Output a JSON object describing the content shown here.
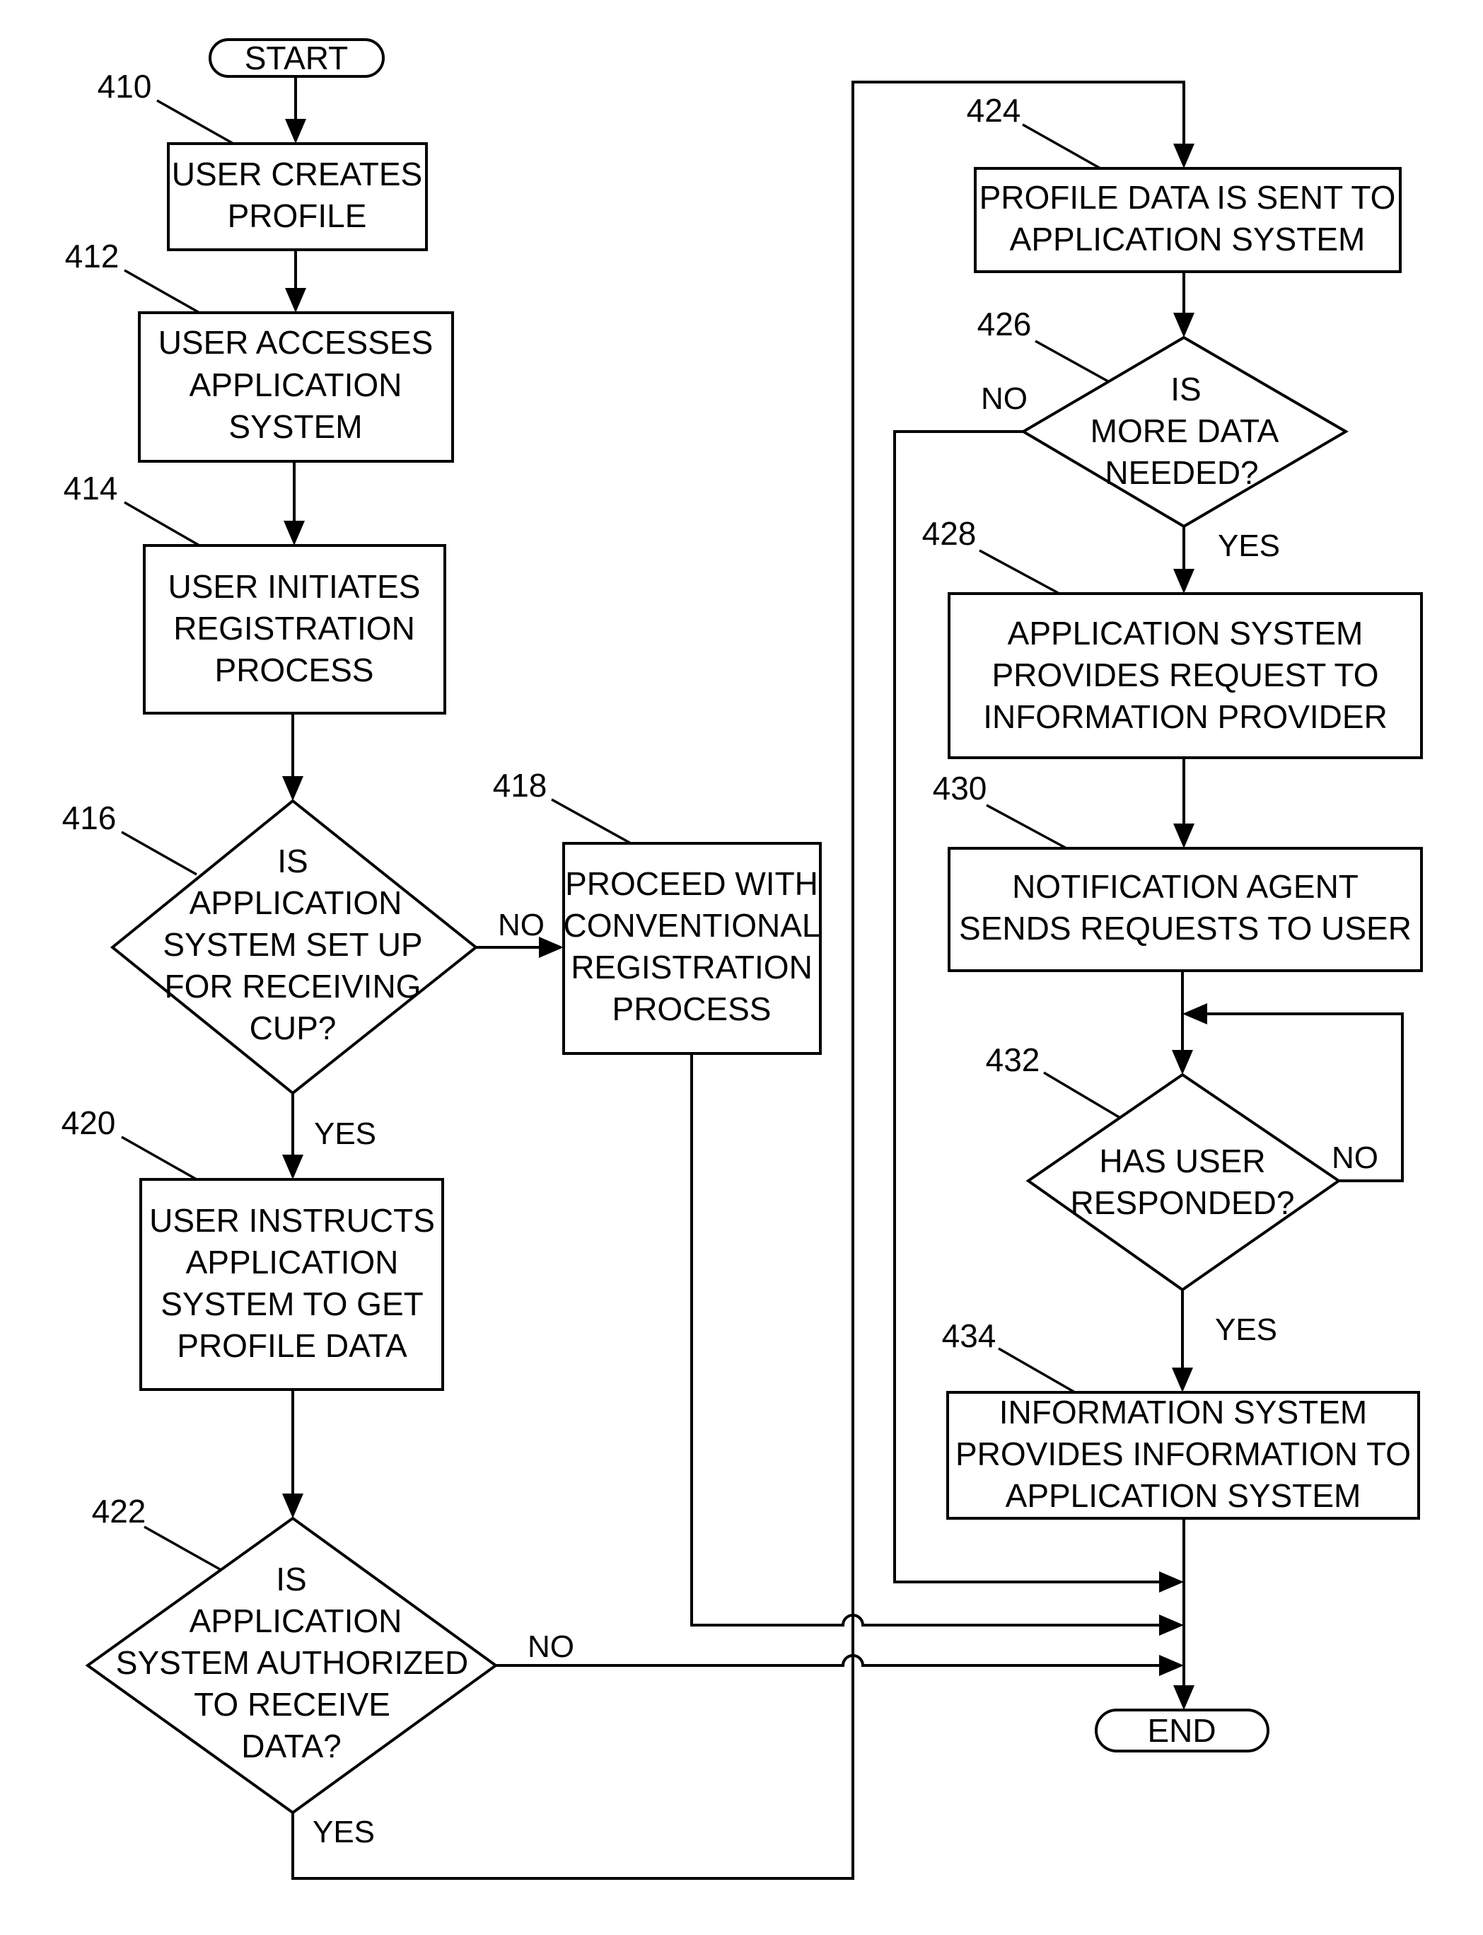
{
  "diagram": {
    "type": "flowchart",
    "terminals": {
      "start": "START",
      "end": "END"
    },
    "steps": [
      {
        "id": "410",
        "ref": "410",
        "kind": "process",
        "lines": [
          "USER CREATES",
          "PROFILE"
        ]
      },
      {
        "id": "412",
        "ref": "412",
        "kind": "process",
        "lines": [
          "USER ACCESSES",
          "APPLICATION",
          "SYSTEM"
        ]
      },
      {
        "id": "414",
        "ref": "414",
        "kind": "process",
        "lines": [
          "USER INITIATES",
          "REGISTRATION",
          "PROCESS"
        ]
      },
      {
        "id": "416",
        "ref": "416",
        "kind": "decision",
        "lines": [
          "IS",
          "APPLICATION",
          "SYSTEM SET UP",
          "FOR RECEIVING",
          "CUP?"
        ]
      },
      {
        "id": "418",
        "ref": "418",
        "kind": "process",
        "lines": [
          "PROCEED WITH",
          "CONVENTIONAL",
          "REGISTRATION",
          "PROCESS"
        ]
      },
      {
        "id": "420",
        "ref": "420",
        "kind": "process",
        "lines": [
          "USER INSTRUCTS",
          "APPLICATION",
          "SYSTEM TO GET",
          "PROFILE DATA"
        ]
      },
      {
        "id": "422",
        "ref": "422",
        "kind": "decision",
        "lines": [
          "IS",
          "APPLICATION",
          "SYSTEM AUTHORIZED",
          "TO RECEIVE",
          "DATA?"
        ]
      },
      {
        "id": "424",
        "ref": "424",
        "kind": "process",
        "lines": [
          "PROFILE DATA IS SENT TO",
          "APPLICATION SYSTEM"
        ]
      },
      {
        "id": "426",
        "ref": "426",
        "kind": "decision",
        "lines": [
          "IS",
          "MORE DATA",
          "NEEDED?"
        ]
      },
      {
        "id": "428",
        "ref": "428",
        "kind": "process",
        "lines": [
          "APPLICATION SYSTEM",
          "PROVIDES REQUEST TO",
          "INFORMATION PROVIDER"
        ]
      },
      {
        "id": "430",
        "ref": "430",
        "kind": "process",
        "lines": [
          "NOTIFICATION AGENT",
          "SENDS REQUESTS TO USER"
        ]
      },
      {
        "id": "432",
        "ref": "432",
        "kind": "decision",
        "lines": [
          "HAS USER",
          "RESPONDED?"
        ]
      },
      {
        "id": "434",
        "ref": "434",
        "kind": "process",
        "lines": [
          "INFORMATION SYSTEM",
          "PROVIDES INFORMATION TO",
          "APPLICATION SYSTEM"
        ]
      }
    ],
    "edge_labels": {
      "d416_no": "NO",
      "d416_yes": "YES",
      "d422_no": "NO",
      "d422_yes": "YES",
      "d426_no": "NO",
      "d426_yes": "YES",
      "d432_no": "NO",
      "d432_yes": "YES"
    },
    "edges": [
      {
        "from": "start",
        "to": "410"
      },
      {
        "from": "410",
        "to": "412"
      },
      {
        "from": "412",
        "to": "414"
      },
      {
        "from": "414",
        "to": "416"
      },
      {
        "from": "416",
        "to": "418",
        "label": "NO"
      },
      {
        "from": "416",
        "to": "420",
        "label": "YES"
      },
      {
        "from": "420",
        "to": "422"
      },
      {
        "from": "422",
        "to": "424",
        "label": "YES"
      },
      {
        "from": "422",
        "to": "end",
        "label": "NO"
      },
      {
        "from": "418",
        "to": "end"
      },
      {
        "from": "424",
        "to": "426"
      },
      {
        "from": "426",
        "to": "428",
        "label": "YES"
      },
      {
        "from": "426",
        "to": "end",
        "label": "NO"
      },
      {
        "from": "428",
        "to": "430"
      },
      {
        "from": "430",
        "to": "432"
      },
      {
        "from": "432",
        "to": "432",
        "label": "NO"
      },
      {
        "from": "432",
        "to": "434",
        "label": "YES"
      },
      {
        "from": "434",
        "to": "end"
      }
    ]
  }
}
